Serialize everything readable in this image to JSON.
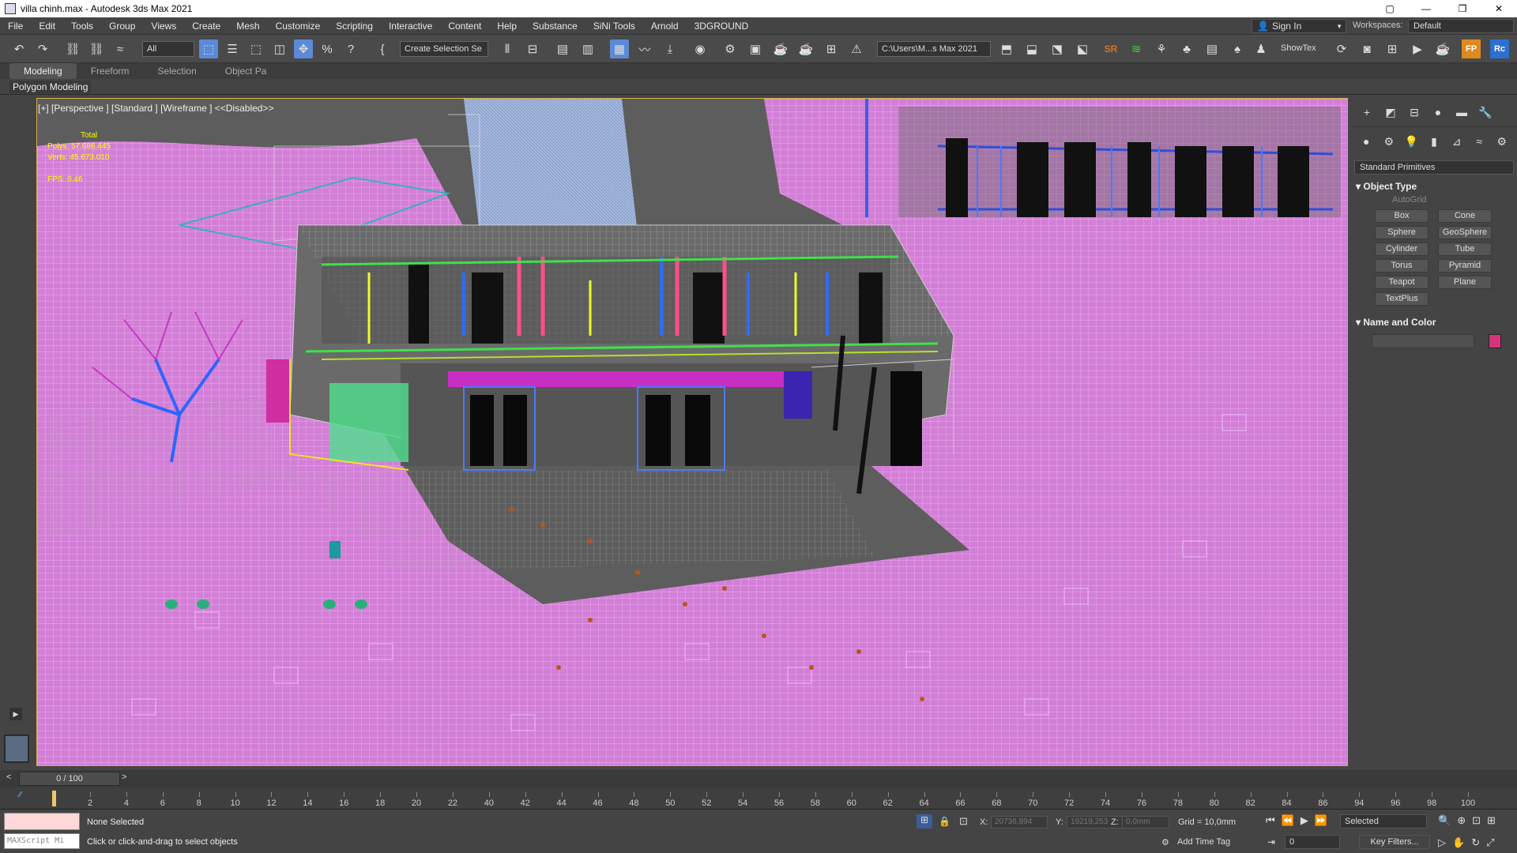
{
  "titlebar": {
    "title": "villa chinh.max - Autodesk 3ds Max 2021"
  },
  "menu": [
    "File",
    "Edit",
    "Tools",
    "Group",
    "Views",
    "Create",
    "Mesh",
    "Customize",
    "Scripting",
    "Interactive",
    "Content",
    "Help",
    "Substance",
    "SiNi Tools",
    "Arnold",
    "3DGROUND"
  ],
  "signin": {
    "label": "Sign In"
  },
  "workspace": {
    "label": "Workspaces:",
    "value": "Default"
  },
  "toolbar": {
    "filter": "All",
    "selection_set": "Create Selection Se",
    "path": "C:\\Users\\M...s Max 2021",
    "showtex": "ShowTex"
  },
  "ribbon": {
    "tabs": [
      "Modeling",
      "Freeform",
      "Selection",
      "Object Pa"
    ],
    "sub": "Polygon Modeling"
  },
  "viewport": {
    "label": "[+] [Perspective ] [Standard ] [Wireframe ]  <<Disabled>>",
    "stats_total": "Total",
    "stats_polys": "Polys:  57.686.445",
    "stats_verts": "Verts:  45.673.010",
    "fps": "FPS:    0.46"
  },
  "command_panel": {
    "category": "Standard Primitives",
    "object_type": "Object Type",
    "autogrid": "AutoGrid",
    "buttons": [
      "Box",
      "Cone",
      "Sphere",
      "GeoSphere",
      "Cylinder",
      "Tube",
      "Torus",
      "Pyramid",
      "Teapot",
      "Plane",
      "TextPlus"
    ],
    "name_color": "Name and Color",
    "swatch": "#d8327e"
  },
  "timeline": {
    "frame": "0 / 100",
    "ticks": [
      "2",
      "4",
      "6",
      "8",
      "10",
      "12",
      "14",
      "16",
      "18",
      "20",
      "22",
      "40",
      "42",
      "44",
      "46",
      "48",
      "50",
      "52",
      "54",
      "56",
      "58",
      "60",
      "62",
      "64",
      "66",
      "68",
      "70",
      "72",
      "74",
      "76",
      "78",
      "80",
      "82",
      "84",
      "86",
      "94",
      "96",
      "98",
      "100"
    ]
  },
  "status": {
    "line1": "None Selected",
    "line2": "Click or click-and-drag to select objects",
    "maxscript": "MAXScript Mi",
    "x": "20736,894",
    "y": "19219,253",
    "z": "0,0mm",
    "grid": "Grid = 10,0mm",
    "add_time_tag": "Add Time Tag",
    "selected": "Selected",
    "key_filters": "Key Filters...",
    "frame_field": "0"
  }
}
